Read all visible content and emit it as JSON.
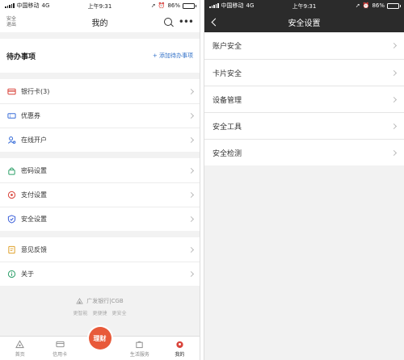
{
  "status": {
    "carrier": "中国移动",
    "network": "4G",
    "time": "上午9:31",
    "battery": "86%",
    "battery_level": 0.86
  },
  "left": {
    "logout_label": "安全\n退出",
    "title": "我的",
    "todo": {
      "title": "待办事项",
      "add_label": "+ 添加待办事项"
    },
    "groups": [
      [
        {
          "label": "银行卡(3)",
          "icon": "bank-card-icon",
          "color": "#d9443b"
        },
        {
          "label": "优惠券",
          "icon": "coupon-icon",
          "color": "#3b6fd9"
        },
        {
          "label": "在线开户",
          "icon": "account-open-icon",
          "color": "#3b6fd9"
        }
      ],
      [
        {
          "label": "密码设置",
          "icon": "lock-icon",
          "color": "#2fa06a"
        },
        {
          "label": "支付设置",
          "icon": "payment-icon",
          "color": "#d9443b"
        },
        {
          "label": "安全设置",
          "icon": "shield-icon",
          "color": "#3b5fd9"
        }
      ],
      [
        {
          "label": "意见反馈",
          "icon": "feedback-icon",
          "color": "#e0a22e"
        },
        {
          "label": "关于",
          "icon": "info-icon",
          "color": "#2fa06a"
        }
      ]
    ],
    "brand": {
      "name": "广发银行|CGB",
      "slogans": [
        "更智能",
        "更便捷",
        "更安全"
      ]
    },
    "tabs": [
      {
        "label": "首页",
        "name": "tab-home"
      },
      {
        "label": "信用卡",
        "name": "tab-credit-card"
      },
      {
        "label": "理财",
        "name": "tab-finance"
      },
      {
        "label": "生活服务",
        "name": "tab-life-services"
      },
      {
        "label": "我的",
        "name": "tab-mine"
      }
    ]
  },
  "right": {
    "title": "安全设置",
    "items": [
      "账户安全",
      "卡片安全",
      "设备管理",
      "安全工具",
      "安全检测"
    ]
  }
}
